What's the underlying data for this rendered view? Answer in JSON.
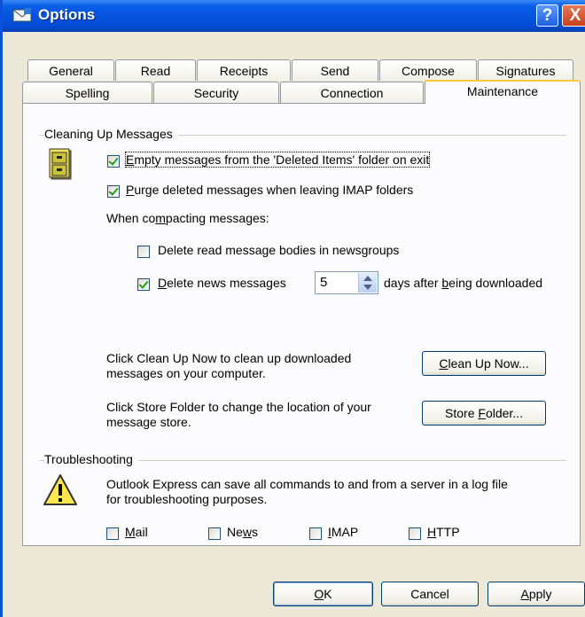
{
  "window": {
    "title": "Options",
    "help_btn": "?",
    "close_btn": "X"
  },
  "tabs_row1": [
    "General",
    "Read",
    "Receipts",
    "Send",
    "Compose",
    "Signatures"
  ],
  "tabs_row2": [
    "Spelling",
    "Security",
    "Connection",
    "Maintenance"
  ],
  "active_tab": "Maintenance",
  "cleaning": {
    "title": "Cleaning Up Messages",
    "empty_deleted_m": "E",
    "empty_deleted_rest": "mpty messages from the 'Deleted Items' folder on exit",
    "empty_deleted_checked": true,
    "purge_m": "P",
    "purge_rest": "urge deleted messages when leaving IMAP folders",
    "purge_checked": true,
    "compacting_a": "When co",
    "compacting_m": "m",
    "compacting_b": "pacting messages:",
    "delete_read_text": "Delete read message bodies in newsgroups",
    "delete_read_checked": false,
    "delete_news_m": "D",
    "delete_news_rest": "elete news messages",
    "delete_news_checked": true,
    "days_value": "5",
    "days_a": "days after ",
    "days_m": "b",
    "days_b": "eing downloaded",
    "cleanup_desc_1": "Click Clean Up Now to clean up downloaded",
    "cleanup_desc_2": "messages on your computer.",
    "cleanup_btn_m": "C",
    "cleanup_btn_rest": "lean Up Now...",
    "store_desc_1": "Click Store Folder to change the location of your",
    "store_desc_2": "message store.",
    "store_btn_a": "Store ",
    "store_btn_m": "F",
    "store_btn_b": "older..."
  },
  "troubleshooting": {
    "title": "Troubleshooting",
    "desc_1": "Outlook Express can save all commands to and from a server in a log file",
    "desc_2": "for troubleshooting purposes.",
    "mail_m": "M",
    "mail_rest": "ail",
    "mail_checked": false,
    "news_a": "Ne",
    "news_m": "w",
    "news_b": "s",
    "news_checked": false,
    "imap_m": "I",
    "imap_rest": "MAP",
    "imap_checked": false,
    "http_m": "H",
    "http_rest": "TTP",
    "http_checked": false
  },
  "footer": {
    "ok_m": "O",
    "ok_rest": "K",
    "cancel": "Cancel",
    "apply_m": "A",
    "apply_rest": "pply"
  },
  "colors": {
    "titlebar": "#0454e0",
    "dialog_bg": "#ece9d8",
    "panel_bg": "#fcfcfe",
    "tab_highlight": "#ffc83c",
    "check": "#21a121"
  }
}
